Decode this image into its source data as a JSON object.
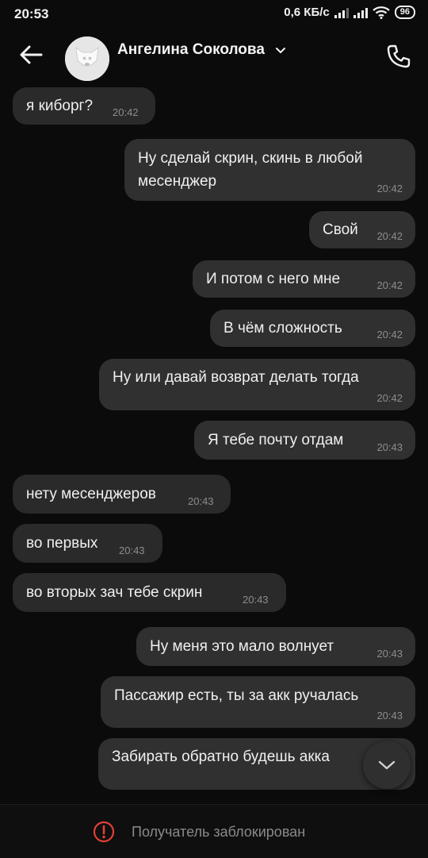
{
  "status_bar": {
    "time": "20:53",
    "network_speed": "0,6 КБ/с",
    "battery": "96"
  },
  "header": {
    "contact_name": "Ангелина Соколова"
  },
  "messages": [
    {
      "text": "я киборг?",
      "time": "20:42",
      "direction": "incoming"
    },
    {
      "text": "Ну сделай скрин, скинь в любой",
      "text2": "месенджер",
      "time": "20:42",
      "direction": "outgoing"
    },
    {
      "text": "Свой",
      "time": "20:42",
      "direction": "outgoing"
    },
    {
      "text": "И потом с него мне",
      "time": "20:42",
      "direction": "outgoing"
    },
    {
      "text": "В чём сложность",
      "time": "20:42",
      "direction": "outgoing"
    },
    {
      "text": "Ну или давай возврат делать тогда",
      "time": "20:42",
      "direction": "outgoing"
    },
    {
      "text": "Я тебе почту отдам",
      "time": "20:43",
      "direction": "outgoing"
    },
    {
      "text": "нету месенджеров",
      "time": "20:43",
      "direction": "incoming"
    },
    {
      "text": "во первых",
      "time": "20:43",
      "direction": "incoming"
    },
    {
      "text": "во вторых зач тебе скрин",
      "time": "20:43",
      "direction": "incoming"
    },
    {
      "text": "Ну меня это мало волнует",
      "time": "20:43",
      "direction": "outgoing"
    },
    {
      "text": "Пассажир есть, ты за акк ручалась",
      "time": "20:43",
      "direction": "outgoing"
    },
    {
      "text": "Забирать обратно будешь акка",
      "time": "",
      "direction": "outgoing"
    }
  ],
  "footer": {
    "blocked_label": "Получатель заблокирован"
  },
  "colors": {
    "background": "#0b0b0b",
    "bubble": "#303030",
    "warning": "#e0403a"
  }
}
